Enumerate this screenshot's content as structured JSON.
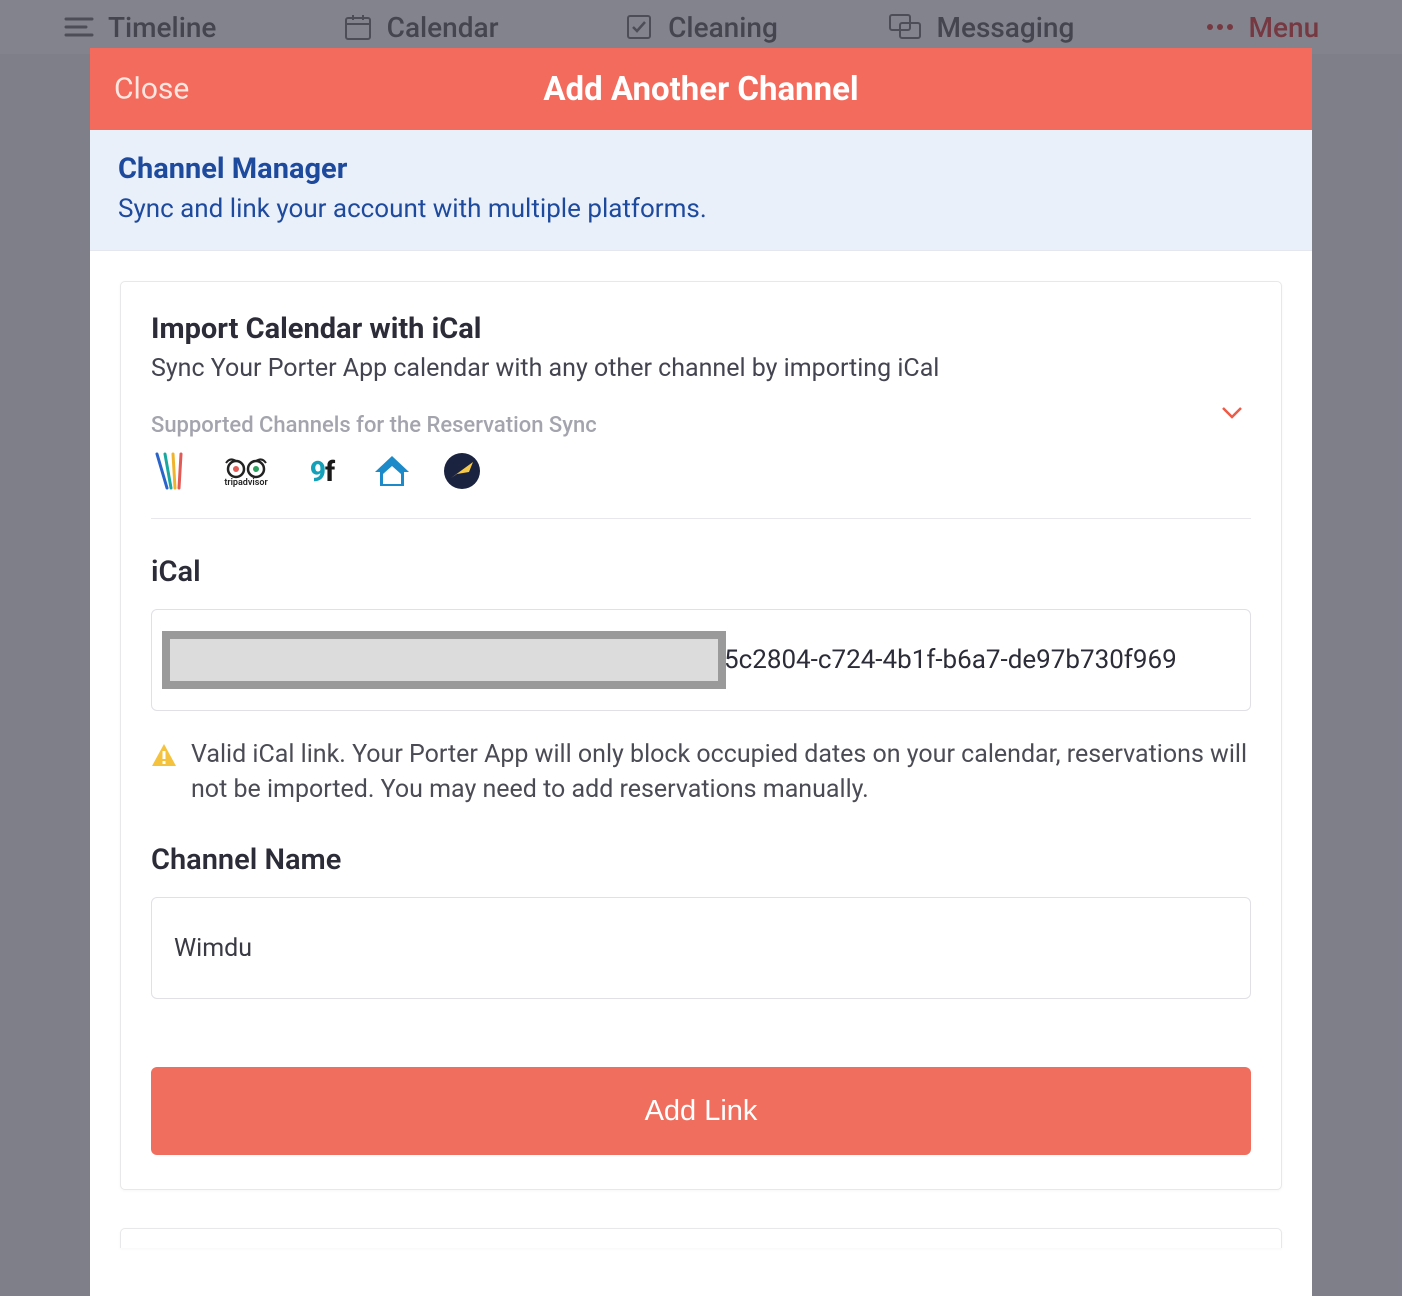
{
  "topnav": {
    "timeline": "Timeline",
    "calendar": "Calendar",
    "cleaning": "Cleaning",
    "messaging": "Messaging",
    "menu": "Menu"
  },
  "modal": {
    "close": "Close",
    "title": "Add Another Channel"
  },
  "subheader": {
    "title": "Channel Manager",
    "subtitle": "Sync and link your account with multiple platforms."
  },
  "import": {
    "title": "Import Calendar with iCal",
    "subtitle": "Sync Your Porter App calendar with any other channel by importing iCal",
    "supported_label": "Supported Channels for the Reservation Sync"
  },
  "ical": {
    "label": "iCal",
    "value_tail": "5c2804-c724-4b1f-b6a7-de97b730f969",
    "validation_message": "Valid iCal link. Your Porter App will only block occupied dates on your calendar, reservations will not be imported. You may need to add reservations manually."
  },
  "channel_name": {
    "label": "Channel Name",
    "value": "Wimdu"
  },
  "buttons": {
    "add_link": "Add Link"
  }
}
